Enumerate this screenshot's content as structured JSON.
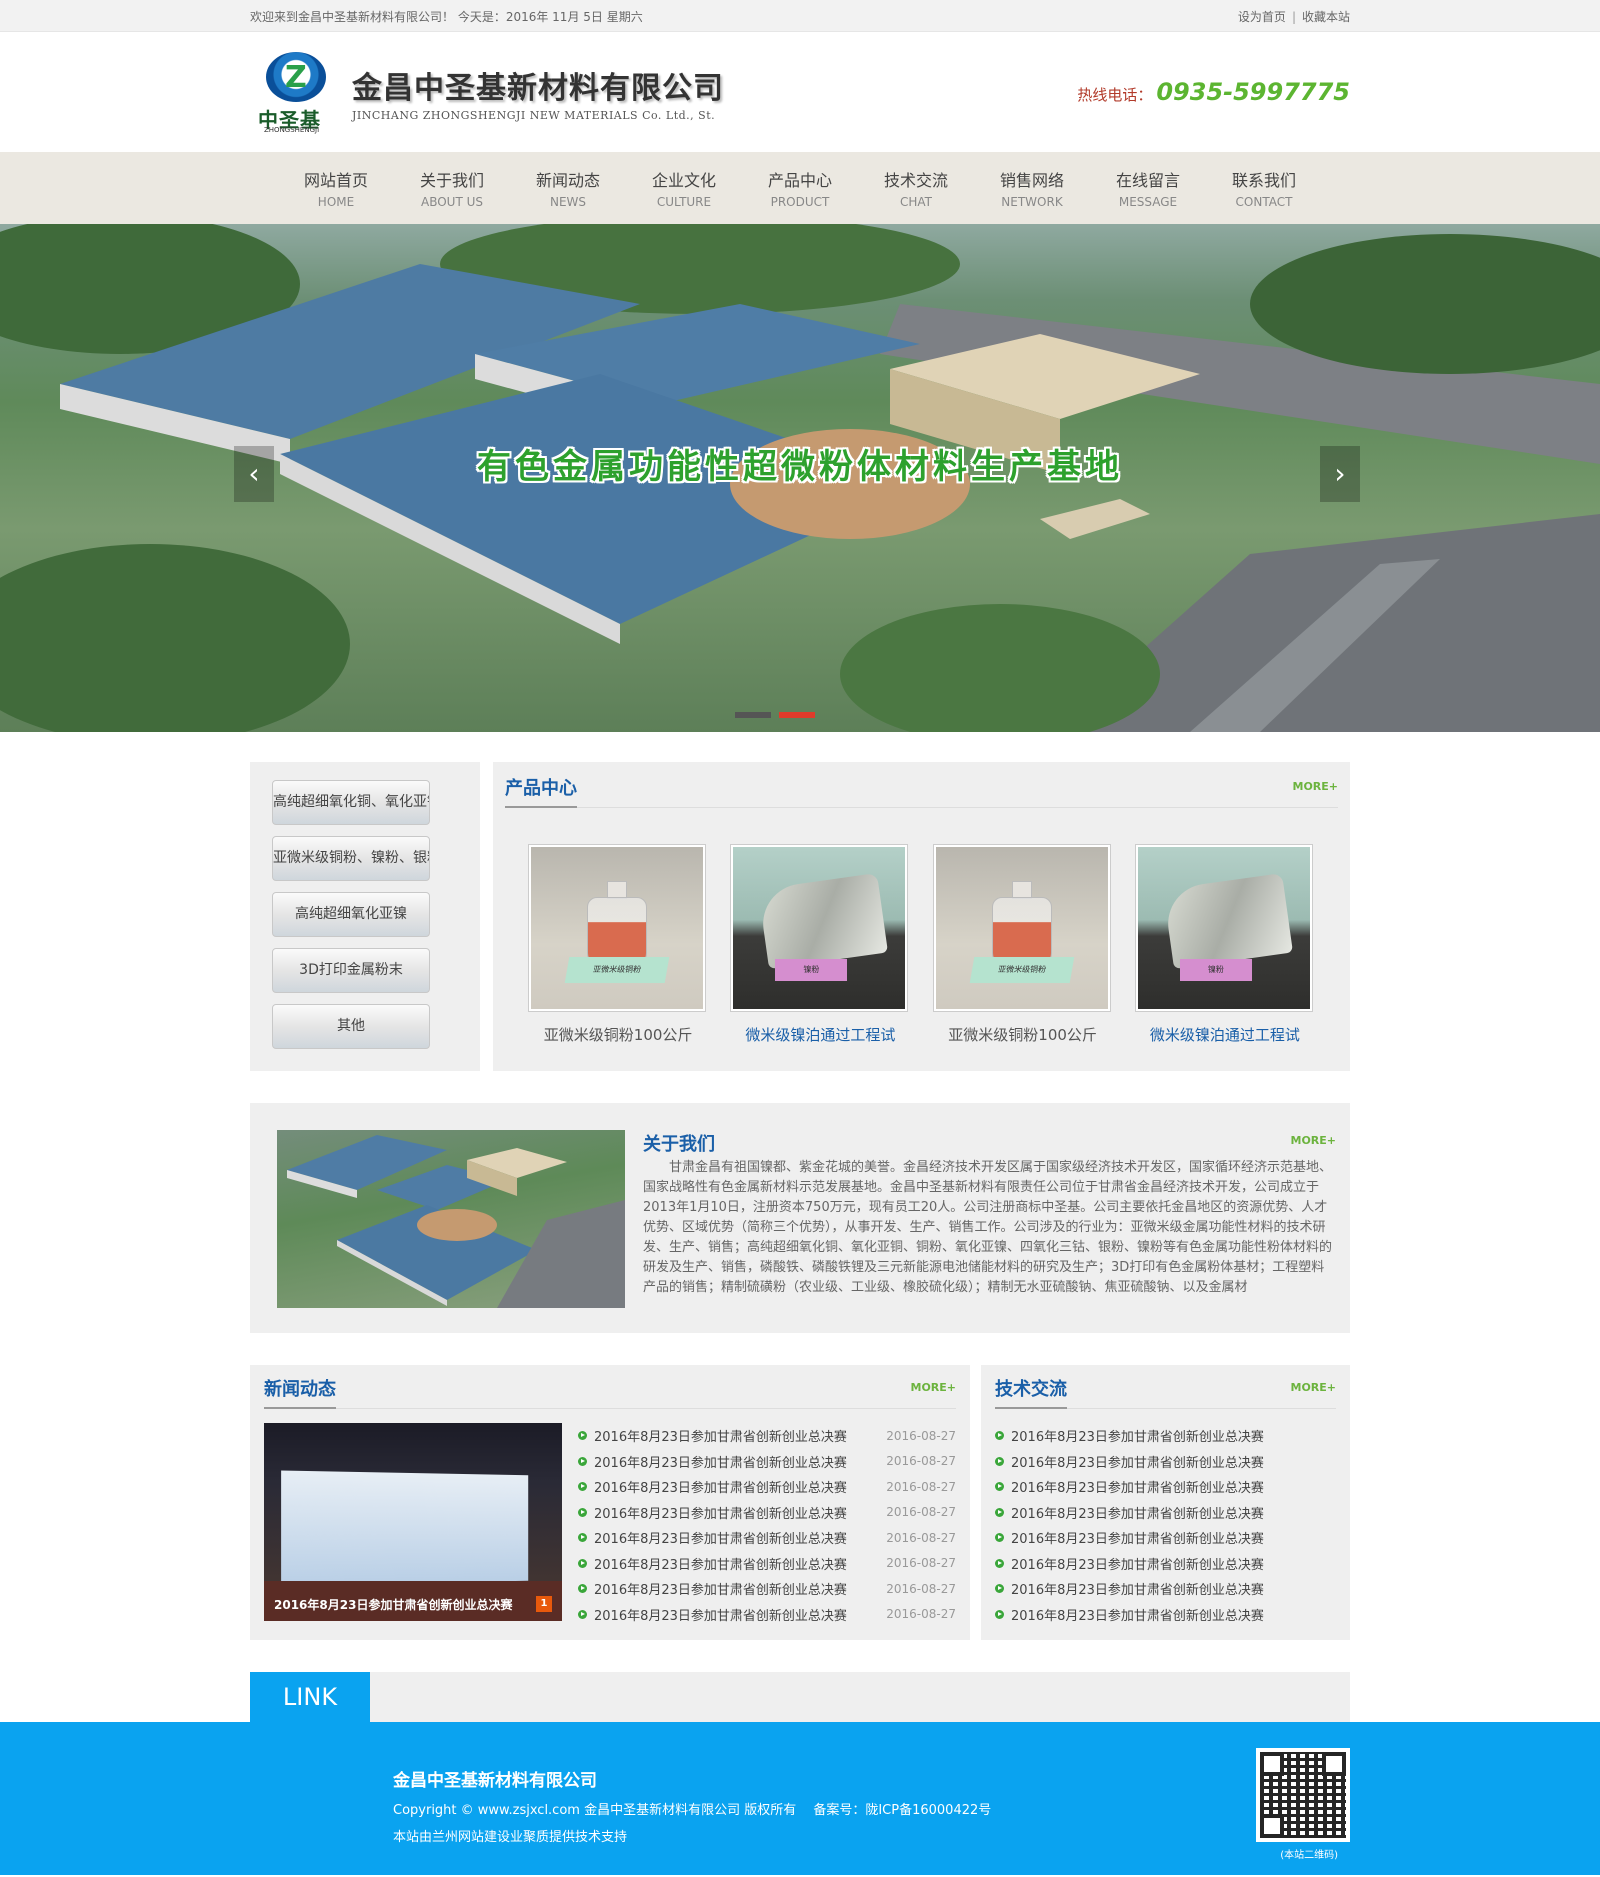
{
  "topbar": {
    "welcome": "欢迎来到金昌中圣基新材料有限公司！ 今天是：2016年 11月 5日 星期六",
    "set_home": "设为首页",
    "favorite": "收藏本站"
  },
  "header": {
    "logo_cn": "中圣基",
    "logo_en": "ZHONGSHENGJI",
    "company_cn": "金昌中圣基新材料有限公司",
    "company_en": "JINCHANG ZHONGSHENGJI NEW MATERIALS Co. Ltd., St.",
    "hotline_label": "热线电话：",
    "hotline_number": "0935-5997775"
  },
  "nav": [
    {
      "zh": "网站首页",
      "en": "HOME"
    },
    {
      "zh": "关于我们",
      "en": "ABOUT US"
    },
    {
      "zh": "新闻动态",
      "en": "NEWS"
    },
    {
      "zh": "企业文化",
      "en": "CULTURE"
    },
    {
      "zh": "产品中心",
      "en": "PRODUCT"
    },
    {
      "zh": "技术交流",
      "en": "CHAT"
    },
    {
      "zh": "销售网络",
      "en": "NETWORK"
    },
    {
      "zh": "在线留言",
      "en": "MESSAGE"
    },
    {
      "zh": "联系我们",
      "en": "CONTACT"
    }
  ],
  "banner": {
    "slogan": "有色金属功能性超微粉体材料生产基地"
  },
  "sidebar": [
    "高纯超细氧化铜、氧化亚铜",
    "亚微米级铜粉、镍粉、银粉",
    "高纯超细氧化亚镍",
    "3D打印金属粉末",
    "其他"
  ],
  "products": {
    "title": "产品中心",
    "more": "MORE+",
    "items": [
      {
        "name": "亚微米级铜粉100公斤",
        "label": "亚微米级铜粉"
      },
      {
        "name": "微米级镍泊通过工程试",
        "label": "镍粉"
      },
      {
        "name": "亚微米级铜粉100公斤",
        "label": "亚微米级铜粉"
      },
      {
        "name": "微米级镍泊通过工程试",
        "label": "镍粉"
      }
    ]
  },
  "about": {
    "title": "关于我们",
    "more": "MORE+",
    "text": "甘肃金昌有祖国镍都、紫金花城的美誉。金昌经济技术开发区属于国家级经济技术开发区，国家循环经济示范基地、国家战略性有色金属新材料示范发展基地。金昌中圣基新材料有限责任公司位于甘肃省金昌经济技术开发，公司成立于2013年1月10日，注册资本750万元，现有员工20人。公司注册商标中圣基。公司主要依托金昌地区的资源优势、人才优势、区域优势（简称三个优势），从事开发、生产、销售工作。公司涉及的行业为：亚微米级金属功能性材料的技术研发、生产、销售；高纯超细氧化铜、氧化亚铜、铜粉、氧化亚镍、四氧化三钴、银粉、镍粉等有色金属功能性粉体材料的研发及生产、销售，磷酸铁、磷酸铁锂及三元新能源电池储能材料的研究及生产；3D打印有色金属粉体基材；工程塑料产品的销售；精制硫磺粉（农业级、工业级、橡胶硫化级）；精制无水亚硫酸钠、焦亚硫酸钠、以及金属材"
  },
  "news": {
    "title": "新闻动态",
    "more": "MORE+",
    "caption": "2016年8月23日参加甘肃省创新创业总决赛",
    "caption_num": "1",
    "items": [
      {
        "title": "2016年8月23日参加甘肃省创新创业总决赛",
        "date": "2016-08-27"
      },
      {
        "title": "2016年8月23日参加甘肃省创新创业总决赛",
        "date": "2016-08-27"
      },
      {
        "title": "2016年8月23日参加甘肃省创新创业总决赛",
        "date": "2016-08-27"
      },
      {
        "title": "2016年8月23日参加甘肃省创新创业总决赛",
        "date": "2016-08-27"
      },
      {
        "title": "2016年8月23日参加甘肃省创新创业总决赛",
        "date": "2016-08-27"
      },
      {
        "title": "2016年8月23日参加甘肃省创新创业总决赛",
        "date": "2016-08-27"
      },
      {
        "title": "2016年8月23日参加甘肃省创新创业总决赛",
        "date": "2016-08-27"
      },
      {
        "title": "2016年8月23日参加甘肃省创新创业总决赛",
        "date": "2016-08-27"
      }
    ]
  },
  "tech": {
    "title": "技术交流",
    "more": "MORE+",
    "items": [
      "2016年8月23日参加甘肃省创新创业总决赛",
      "2016年8月23日参加甘肃省创新创业总决赛",
      "2016年8月23日参加甘肃省创新创业总决赛",
      "2016年8月23日参加甘肃省创新创业总决赛",
      "2016年8月23日参加甘肃省创新创业总决赛",
      "2016年8月23日参加甘肃省创新创业总决赛",
      "2016年8月23日参加甘肃省创新创业总决赛",
      "2016年8月23日参加甘肃省创新创业总决赛"
    ]
  },
  "link": {
    "title": "LINK"
  },
  "footer": {
    "company": "金昌中圣基新材料有限公司",
    "copyright": "Copyright © www.zsjxcl.com 金昌中圣基新材料有限公司 版权所有　 备案号：陇ICP备16000422号",
    "support": "本站由兰州网站建设业聚质提供技术支持",
    "qr_caption": "(本站二维码)"
  },
  "colors": {
    "accent_blue": "#0aa3f0",
    "title_blue": "#1a5fa8",
    "green": "#5cb531",
    "nav_bg": "#ebe8e1"
  }
}
